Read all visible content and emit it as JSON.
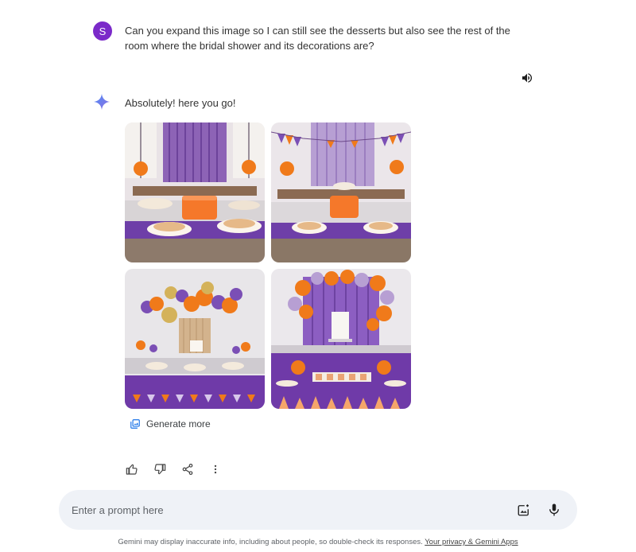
{
  "user": {
    "avatar_initial": "S",
    "avatar_color": "#7b2ac9",
    "message": "Can you expand this image so I can still see the desserts but also see the rest of the room where the bridal shower and its decorations are?"
  },
  "response": {
    "text": "Absolutely! here you go!",
    "images": [
      {
        "name": "dessert-table-image-1"
      },
      {
        "name": "dessert-table-image-2"
      },
      {
        "name": "dessert-table-image-3"
      },
      {
        "name": "dessert-table-image-4"
      }
    ],
    "generate_more_label": "Generate more"
  },
  "actions": {
    "icons": [
      "thumbs-up-icon",
      "thumbs-down-icon",
      "share-icon",
      "more-vert-icon"
    ]
  },
  "prompt": {
    "placeholder": "Enter a prompt here",
    "icons": [
      "add-image-icon",
      "microphone-icon"
    ]
  },
  "footer": {
    "text": "Gemini may display inaccurate info, including about people, so double-check its responses.",
    "link": "Your privacy & Gemini Apps"
  },
  "colors": {
    "accent_purple": "#7b4fb5",
    "accent_orange": "#f07a1a",
    "prompt_bg": "#eff2f7"
  }
}
